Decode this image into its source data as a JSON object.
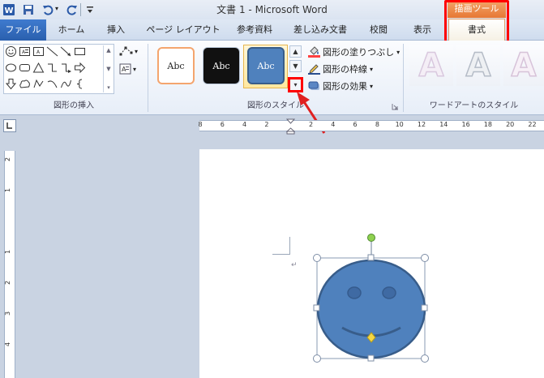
{
  "window": {
    "title": "文書 1  -  Microsoft Word",
    "qat": [
      "word-app-icon",
      "save-icon",
      "undo-icon",
      "redo-icon",
      "customize-icon"
    ]
  },
  "contextual": {
    "group_label": "描画ツール"
  },
  "tabs": [
    {
      "label": "ファイル"
    },
    {
      "label": "ホーム"
    },
    {
      "label": "挿入"
    },
    {
      "label": "ページ レイアウト"
    },
    {
      "label": "参考資料"
    },
    {
      "label": "差し込み文書"
    },
    {
      "label": "校閲"
    },
    {
      "label": "表示"
    },
    {
      "label": "書式"
    }
  ],
  "groups": {
    "insert_shapes": "図形の挿入",
    "shape_styles": "図形のスタイル",
    "wordart_styles": "ワードアートのスタイル"
  },
  "style_gallery": {
    "thumb_text": "Abc"
  },
  "commands": {
    "fill": "図形の塗りつぶし",
    "outline": "図形の枠線",
    "effects": "図形の効果"
  },
  "wordart": {
    "letter": "A"
  },
  "ruler": {
    "h_numbers": [
      "8",
      "6",
      "4",
      "2",
      "",
      "2",
      "4",
      "6",
      "8",
      "10",
      "12",
      "14",
      "16",
      "18",
      "20",
      "22"
    ],
    "v_numbers": [
      "2",
      "1",
      "",
      "1",
      "2",
      "3",
      "4"
    ]
  },
  "colors": {
    "accent_red": "#ff0000",
    "shape_fill": "#4f81bd",
    "shape_stroke": "#385d8a",
    "file_tab": "#2a5fad",
    "context_orange": "#e77834"
  }
}
